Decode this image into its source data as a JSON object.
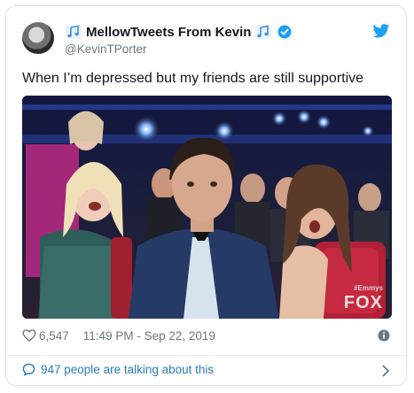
{
  "author": {
    "display_name": "MellowTweets From Kevin",
    "handle": "@KevinTPorter",
    "verified": true
  },
  "tweet": {
    "text": "When I’m depressed but my friends are still supportive"
  },
  "media": {
    "watermark_small": "#Emmys",
    "watermark": "FOX"
  },
  "meta": {
    "likes": "6,547",
    "timestamp": "11:49 PM - Sep 22, 2019"
  },
  "conversation": {
    "label": "947 people are talking about this"
  },
  "colors": {
    "accent": "#1da1f2",
    "link": "#2b7bb9",
    "muted": "#697882"
  }
}
